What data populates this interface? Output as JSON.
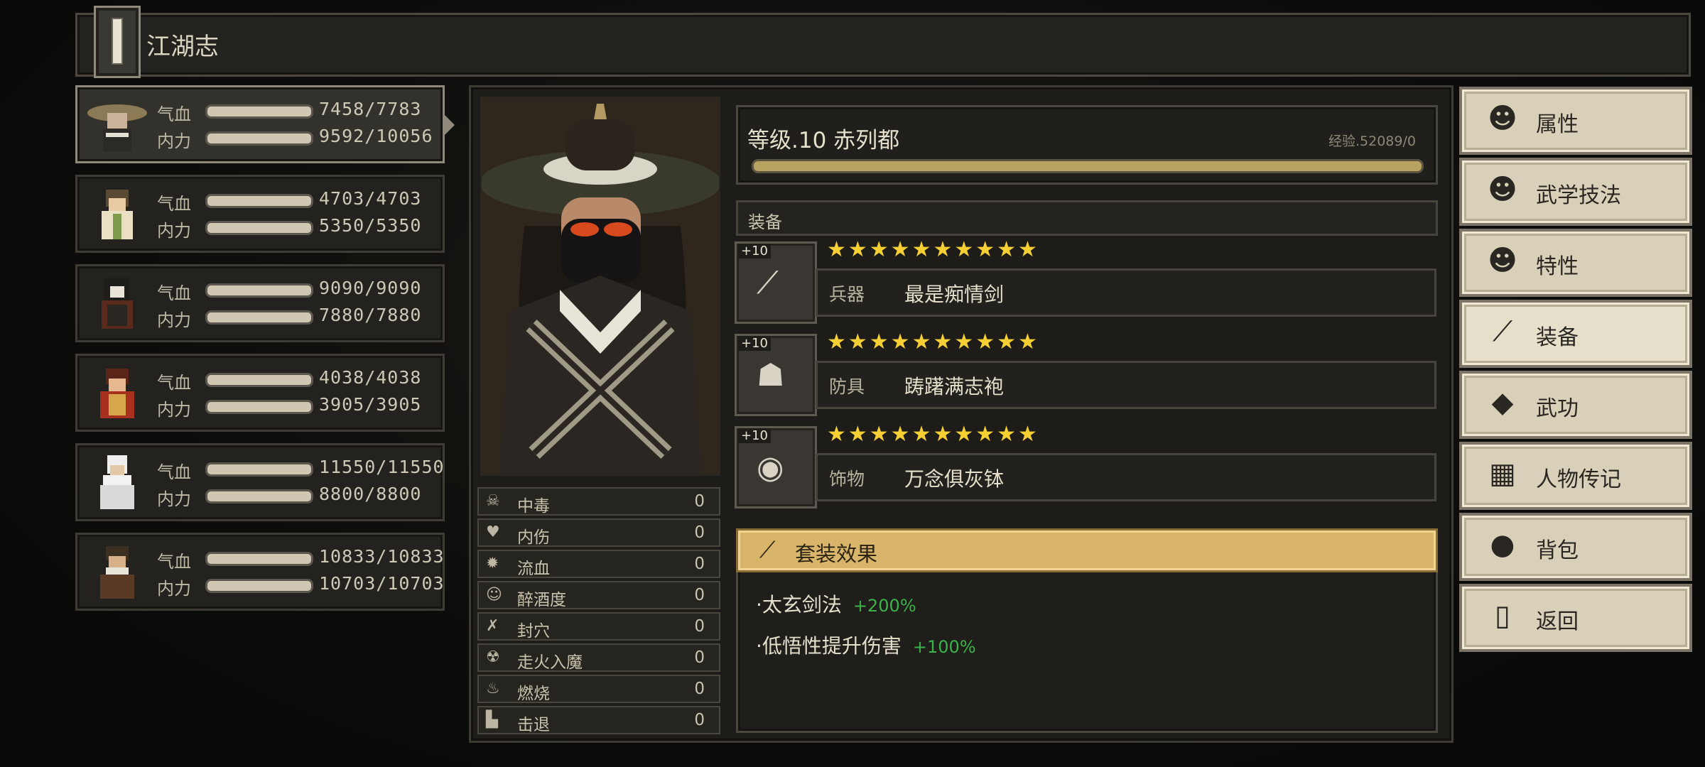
{
  "window": {
    "title": "江湖志"
  },
  "party": [
    {
      "hp_label": "气血",
      "hp": "7458/7783",
      "mp_label": "内力",
      "mp": "9592/10056"
    },
    {
      "hp_label": "气血",
      "hp": "4703/4703",
      "mp_label": "内力",
      "mp": "5350/5350"
    },
    {
      "hp_label": "气血",
      "hp": "9090/9090",
      "mp_label": "内力",
      "mp": "7880/7880"
    },
    {
      "hp_label": "气血",
      "hp": "4038/4038",
      "mp_label": "内力",
      "mp": "3905/3905"
    },
    {
      "hp_label": "气血",
      "hp": "11550/11550",
      "mp_label": "内力",
      "mp": "8800/8800"
    },
    {
      "hp_label": "气血",
      "hp": "10833/10833",
      "mp_label": "内力",
      "mp": "10703/10703"
    }
  ],
  "character": {
    "level_line": "等级.10 赤列都",
    "exp": "经验.52089/0"
  },
  "status_effects": [
    {
      "icon": "skull-icon",
      "glyph": "☠",
      "name": "中毒",
      "value": "0"
    },
    {
      "icon": "broken-heart-icon",
      "glyph": "♥",
      "name": "内伤",
      "value": "0"
    },
    {
      "icon": "blood-drop-icon",
      "glyph": "✹",
      "name": "流血",
      "value": "0"
    },
    {
      "icon": "drunk-face-icon",
      "glyph": "☺",
      "name": "醉酒度",
      "value": "0"
    },
    {
      "icon": "acupoint-icon",
      "glyph": "✗",
      "name": "封穴",
      "value": "0"
    },
    {
      "icon": "demon-icon",
      "glyph": "☢",
      "name": "走火入魔",
      "value": "0"
    },
    {
      "icon": "flame-icon",
      "glyph": "♨",
      "name": "燃烧",
      "value": "0"
    },
    {
      "icon": "boot-icon",
      "glyph": "▙",
      "name": "击退",
      "value": "0"
    }
  ],
  "equipment": {
    "header": "装备",
    "stars": "★★★★★★★★★★",
    "items": [
      {
        "plus": "+10",
        "type": "兵器",
        "name": "最是痴情剑",
        "icon": "sword-icon",
        "glyph": "⟋"
      },
      {
        "plus": "+10",
        "type": "防具",
        "name": "踌躇满志袍",
        "icon": "robe-icon",
        "glyph": "☗"
      },
      {
        "plus": "+10",
        "type": "饰物",
        "name": "万念俱灰钵",
        "icon": "bowl-icon",
        "glyph": "◉"
      }
    ]
  },
  "set_bonus": {
    "title": "套装效果",
    "effects": [
      {
        "name": "·太玄剑法",
        "value": "+200%"
      },
      {
        "name": "·低悟性提升伤害",
        "value": "+100%"
      }
    ]
  },
  "menu": [
    {
      "label": "属性",
      "icon": "character-icon",
      "glyph": "☻"
    },
    {
      "label": "武学技法",
      "icon": "martial-arts-icon",
      "glyph": "☻"
    },
    {
      "label": "特性",
      "icon": "trait-icon",
      "glyph": "☻"
    },
    {
      "label": "装备",
      "icon": "sword-icon",
      "glyph": "⟋"
    },
    {
      "label": "武功",
      "icon": "manual-book-icon",
      "glyph": "◆"
    },
    {
      "label": "人物传记",
      "icon": "scroll-icon",
      "glyph": "▦"
    },
    {
      "label": "背包",
      "icon": "bag-icon",
      "glyph": "●"
    },
    {
      "label": "返回",
      "icon": "door-icon",
      "glyph": "▯"
    }
  ],
  "colors": {
    "accent_gold": "#d9b56b",
    "stars": "#f5cf33",
    "bonus_green": "#3bb34a",
    "menu_bg": "#d8d0b8"
  }
}
